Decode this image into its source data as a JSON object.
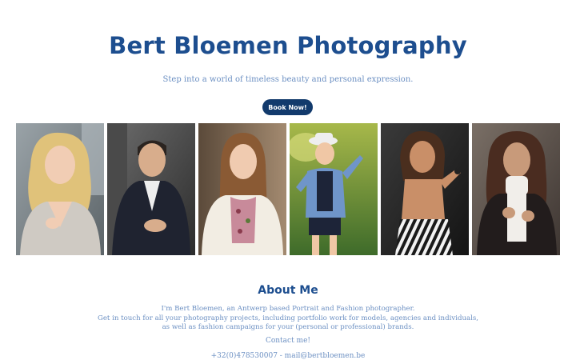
{
  "header": {
    "title": "Bert Bloemen Photography",
    "tagline": "Step into a world of timeless beauty and personal expression.",
    "book_button": "Book Now!"
  },
  "gallery": {
    "photos": [
      {
        "subject": "blonde woman in grey knit cardigan"
      },
      {
        "subject": "man in dark suit jacket"
      },
      {
        "subject": "young woman in white coat and floral top"
      },
      {
        "subject": "boy in hat and denim jacket"
      },
      {
        "subject": "woman in striped dress holding sunglasses"
      },
      {
        "subject": "woman in white turtleneck and black coat"
      }
    ]
  },
  "about": {
    "heading": "About Me",
    "line1": "I'm Bert Bloemen, an Antwerp based Portrait and Fashion photographer.",
    "line2": "Get in touch for all your photography projects, including portfolio work for models, agencies and individuals,",
    "line3": "as well as fashion campaigns for your (personal or professional) brands.",
    "contact_link": "Contact me!",
    "contact_info": "+32(0)478530007 - mail@bertbloemen.be"
  },
  "colors": {
    "title": "#1d4e8f",
    "text": "#6b8fc2",
    "button": "#123a6c"
  }
}
